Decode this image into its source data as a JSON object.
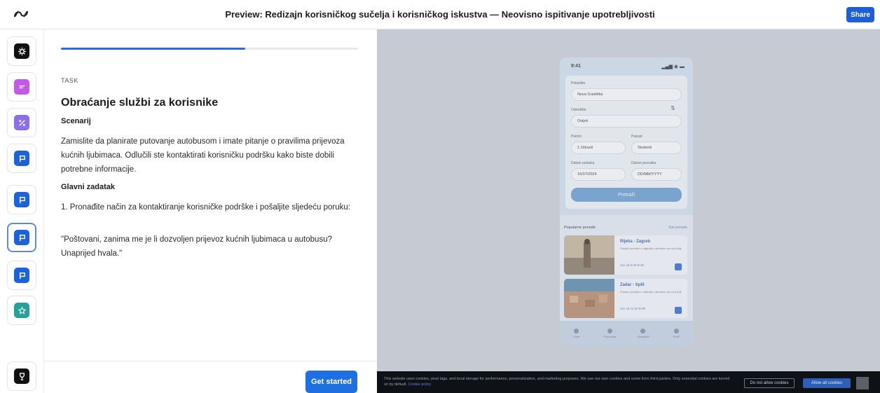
{
  "header": {
    "title": "Preview: Redizajn korisničkog sučelja i korisničkog iskustva — Neovisno ispitivanje upotrebljivosti",
    "share_label": "Share"
  },
  "rail": {
    "items": [
      {
        "icon": "gear-icon",
        "color": "#111111"
      },
      {
        "icon": "lines-icon",
        "color": "#c25ae3"
      },
      {
        "icon": "percent-icon",
        "color": "#8a6fe8"
      },
      {
        "icon": "flag-icon",
        "color": "#1e62d8"
      },
      {
        "icon": "flag-icon",
        "color": "#1e62d8"
      },
      {
        "icon": "flag-icon",
        "color": "#1e62d8",
        "active": true
      },
      {
        "icon": "flag-icon",
        "color": "#1e62d8"
      },
      {
        "icon": "star-icon",
        "color": "#2aa198"
      },
      {
        "icon": "trophy-icon",
        "color": "#111111"
      }
    ]
  },
  "task": {
    "progress": 0.62,
    "label": "TASK",
    "title": "Obraćanje službi za korisnike",
    "scenario_heading": "Scenarij",
    "scenario_text": "Zamislite da planirate putovanje autobusom i imate pitanje o pravilima prijevoza kućnih ljubimaca. Odlučili ste kontaktirati korisničku podršku kako biste dobili potrebne informacije.",
    "main_heading": "Glavni zadatak",
    "main_text": "1. Pronađite način za kontaktiranje korisničke podrške i pošaljite sljedeću poruku:",
    "quote": "\"Poštovani, zanima me je li dozvoljen prijevoz kućnih ljubimaca u autobusu? Unaprijed hvala.\"",
    "start_label": "Get started"
  },
  "phone": {
    "time": "9:41",
    "from_label": "Polazište",
    "from_value": "Nova Gradiška",
    "to_label": "Odredište",
    "to_value": "Osijek",
    "passengers_label": "Putnici",
    "passengers_value": "1 Odrasli",
    "discount_label": "Popust",
    "discount_value": "Studenti",
    "depart_label": "Datum polaska",
    "depart_value": "15/07/2024",
    "return_label": "Datum povratka",
    "return_value": "DD/MM/YYYY",
    "search_label": "Pretraži",
    "section_title": "Popularne ponude",
    "section_link": "Sve ponude",
    "offers": [
      {
        "title": "Rijeka - Zagreb",
        "desc": "Putujte povoljno s najboljim cijenama na ovoj liniji",
        "price": "već od 9,00 EUR"
      },
      {
        "title": "Zadar - Split",
        "desc": "Putujte povoljno s najboljim cijenama na ovoj liniji",
        "price": "već od 11,00 EUR"
      }
    ],
    "nav": [
      "Karte",
      "Putovanja",
      "Obavijesti",
      "Profil"
    ]
  },
  "cookie": {
    "text": "This website uses cookies, pixel tags, and local storage for performance, personalization, and marketing purposes. We use our own cookies and some from third parties. Only essential cookies are turned on by default.",
    "link": "Cookie policy",
    "deny_label": "Do not allow cookies",
    "allow_label": "Allow all cookies"
  }
}
